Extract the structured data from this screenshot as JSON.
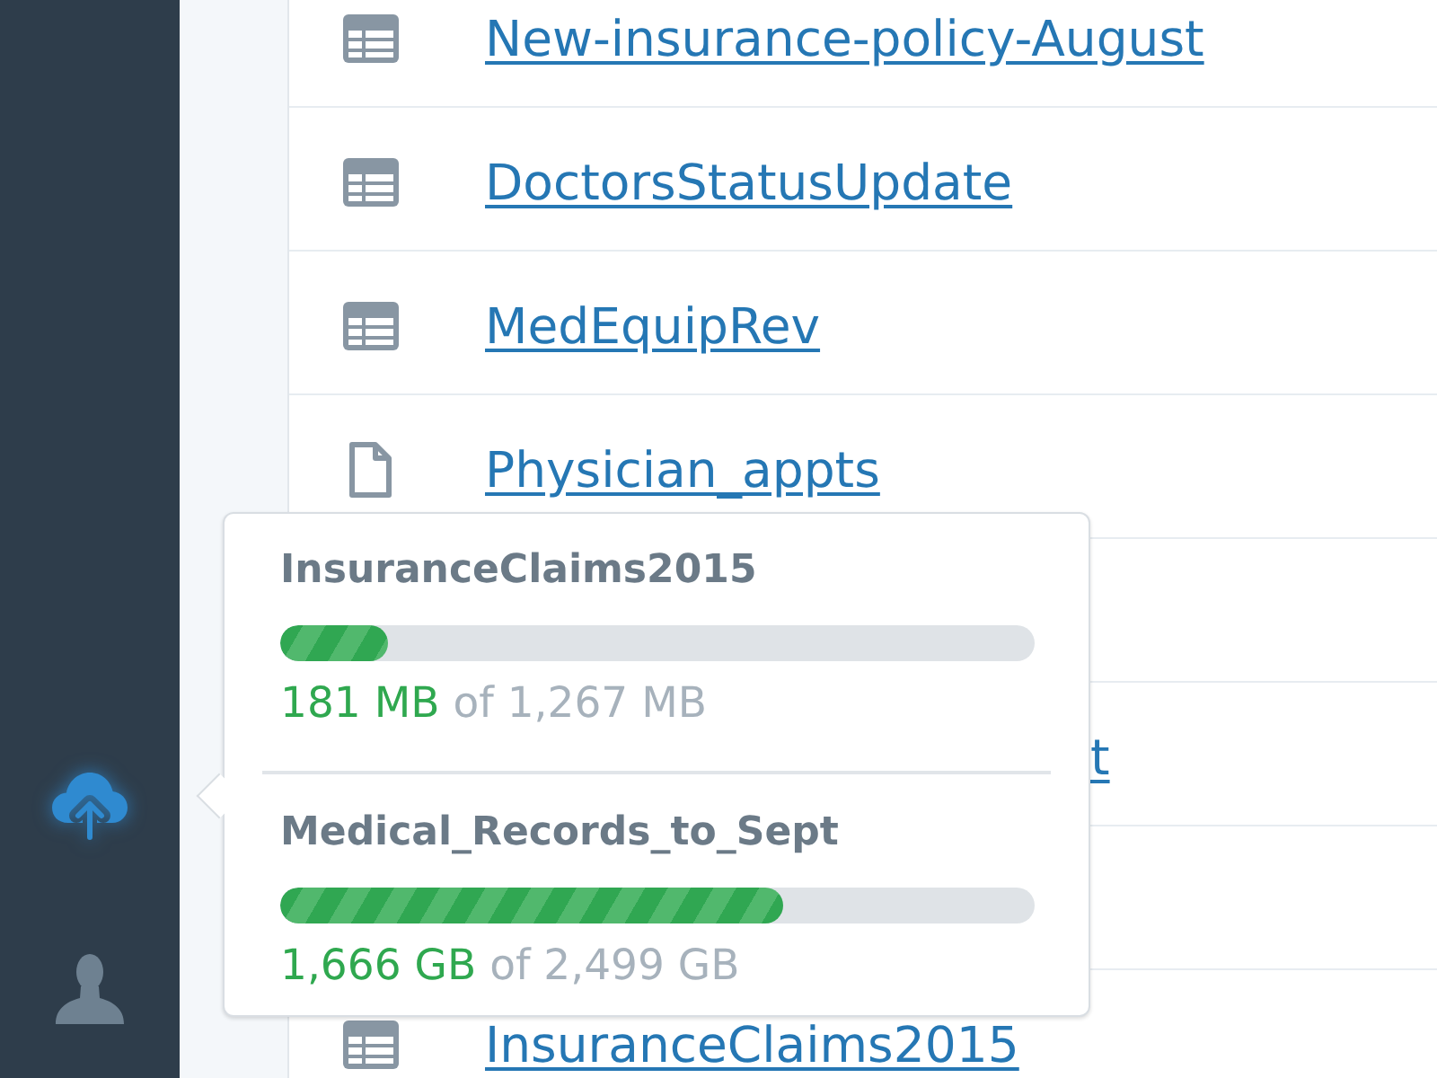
{
  "sidebar": {
    "items": [
      {
        "kind": "upload",
        "selected": true
      },
      {
        "kind": "account",
        "selected": false
      }
    ]
  },
  "files": [
    {
      "kind": "spreadsheet",
      "name": "New-insurance-policy-August"
    },
    {
      "kind": "spreadsheet",
      "name": "DoctorsStatusUpdate"
    },
    {
      "kind": "spreadsheet",
      "name": "MedEquipRev"
    },
    {
      "kind": "document",
      "name": "Physician_appts"
    },
    {
      "kind": "covered"
    },
    {
      "kind": "tail",
      "name": "t"
    },
    {
      "kind": "covered"
    },
    {
      "kind": "spreadsheet",
      "name": "InsuranceClaims2015"
    }
  ],
  "upload_popover": {
    "items": [
      {
        "name": "InsuranceClaims2015",
        "level": 0.143,
        "used": "181 MB",
        "total": "of 1,267 MB"
      },
      {
        "name": "Medical_Records_to_Sept",
        "level": 0.667,
        "used": "1,666 GB",
        "total": "of 2,499 GB"
      }
    ]
  }
}
